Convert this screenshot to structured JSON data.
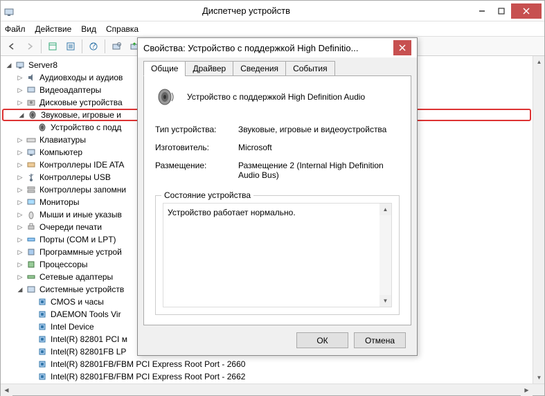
{
  "window": {
    "title": "Диспетчер устройств"
  },
  "menu": {
    "file": "Файл",
    "action": "Действие",
    "view": "Вид",
    "help": "Справка"
  },
  "tree": {
    "root": "Server8",
    "nodes": [
      {
        "label": "Аудиовходы и аудиов",
        "exp": "collapsed",
        "icon": "audio"
      },
      {
        "label": "Видеоадаптеры",
        "exp": "collapsed",
        "icon": "display"
      },
      {
        "label": "Дисковые устройства",
        "exp": "collapsed",
        "icon": "disk"
      },
      {
        "label": "Звуковые, игровые и",
        "exp": "expanded",
        "icon": "sound",
        "highlight": true,
        "children": [
          {
            "label": "Устройство с подд",
            "icon": "sound"
          }
        ]
      },
      {
        "label": "Клавиатуры",
        "exp": "collapsed",
        "icon": "keyboard"
      },
      {
        "label": "Компьютер",
        "exp": "collapsed",
        "icon": "computer"
      },
      {
        "label": "Контроллеры IDE ATA",
        "exp": "collapsed",
        "icon": "ide"
      },
      {
        "label": "Контроллеры USB",
        "exp": "collapsed",
        "icon": "usb"
      },
      {
        "label": "Контроллеры запомни",
        "exp": "collapsed",
        "icon": "storage"
      },
      {
        "label": "Мониторы",
        "exp": "collapsed",
        "icon": "monitor"
      },
      {
        "label": "Мыши и иные указыв",
        "exp": "collapsed",
        "icon": "mouse"
      },
      {
        "label": "Очереди печати",
        "exp": "collapsed",
        "icon": "printer"
      },
      {
        "label": "Порты (COM и LPT)",
        "exp": "collapsed",
        "icon": "port"
      },
      {
        "label": "Программные устрой",
        "exp": "collapsed",
        "icon": "soft"
      },
      {
        "label": "Процессоры",
        "exp": "collapsed",
        "icon": "cpu"
      },
      {
        "label": "Сетевые адаптеры",
        "exp": "collapsed",
        "icon": "net"
      },
      {
        "label": "Системные устройств",
        "exp": "expanded",
        "icon": "system",
        "children": [
          {
            "label": "CMOS и часы",
            "icon": "chip"
          },
          {
            "label": "DAEMON Tools Vir",
            "icon": "chip"
          },
          {
            "label": "Intel Device",
            "icon": "chip"
          },
          {
            "label": "Intel(R) 82801 PCI м",
            "icon": "chip"
          },
          {
            "label": "Intel(R) 82801FB LP",
            "icon": "chip"
          },
          {
            "label": "Intel(R) 82801FB/FBM PCI Express Root Port - 2660",
            "icon": "chip"
          },
          {
            "label": "Intel(R) 82801FB/FBM PCI Express Root Port - 2662",
            "icon": "chip"
          }
        ]
      }
    ]
  },
  "dialog": {
    "title": "Свойства: Устройство с поддержкой High Definitio...",
    "tabs": [
      "Общие",
      "Драйвер",
      "Сведения",
      "События"
    ],
    "device_name": "Устройство с поддержкой High Definition Audio",
    "type_label": "Тип устройства:",
    "type_value": "Звуковые, игровые и видеоустройства",
    "mfr_label": "Изготовитель:",
    "mfr_value": "Microsoft",
    "loc_label": "Размещение:",
    "loc_value": "Размещение 2 (Internal High Definition Audio Bus)",
    "status_group": "Состояние устройства",
    "status_text": "Устройство работает нормально.",
    "ok": "ОК",
    "cancel": "Отмена"
  }
}
